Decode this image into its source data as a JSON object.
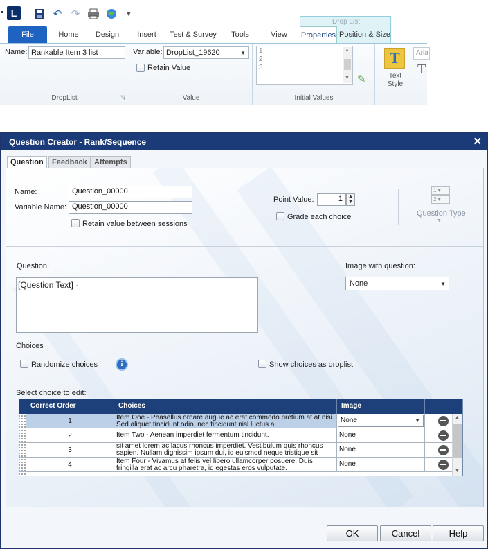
{
  "ribbon": {
    "logo": "L",
    "tabs": [
      "File",
      "Home",
      "Design",
      "Insert",
      "Test & Survey",
      "Tools",
      "View",
      "Properties",
      "Position & Size"
    ],
    "context_group": "Drop List",
    "name_label": "Name:",
    "name_value": "Rankable Item 3 list",
    "variable_label": "Variable:",
    "variable_value": "DropList_19620",
    "retain_label": "Retain Value",
    "initial_values": [
      "1",
      "2",
      "3"
    ],
    "group_droplist": "DropList",
    "group_value": "Value",
    "group_initial": "Initial Values",
    "text_style_label": "Text Style",
    "font_partial": "Aria"
  },
  "dialog": {
    "title": "Question Creator - Rank/Sequence",
    "close": "✕",
    "tabs": [
      "Question",
      "Feedback",
      "Attempts"
    ],
    "name_label": "Name:",
    "name_value": "Question_00000",
    "variable_label": "Variable Name:",
    "variable_value": "Question_00000",
    "retain_label": "Retain value between sessions",
    "point_label": "Point Value:",
    "point_value": "1",
    "grade_label": "Grade each choice",
    "qtype_label": "Question Type",
    "question_label": "Question:",
    "question_text": "[Question Text]",
    "image_label": "Image with question:",
    "image_value": "None",
    "choices_label": "Choices",
    "randomize_label": "Randomize choices",
    "info_icon": "i",
    "droplist_label": "Show choices as droplist",
    "select_label": "Select choice to edit:",
    "columns": [
      "Correct Order",
      "Choices",
      "Image"
    ],
    "rows": [
      {
        "order": "1",
        "choice": "Item One - Phasellus ornare augue ac erat commodo pretium at at nisi. Sed aliquet tincidunt odio, nec tincidunt nisl luctus a.",
        "image": "None"
      },
      {
        "order": "2",
        "choice": "Item Two - Aenean imperdiet fermentum tincidunt.",
        "image": "None"
      },
      {
        "order": "3",
        "choice": "sit amet lorem ac lacus rhoncus imperdiet. Vestibulum quis rhoncus sapien. Nullam dignissim ipsum dui, id euismod neque tristique sit",
        "image": "None"
      },
      {
        "order": "4",
        "choice": "Item Four - Vivamus at felis vel libero ullamcorper posuere. Duis fringilla erat ac arcu pharetra, id egestas eros vulputate.",
        "image": "None"
      }
    ],
    "buttons": {
      "ok": "OK",
      "cancel": "Cancel",
      "help": "Help"
    }
  }
}
